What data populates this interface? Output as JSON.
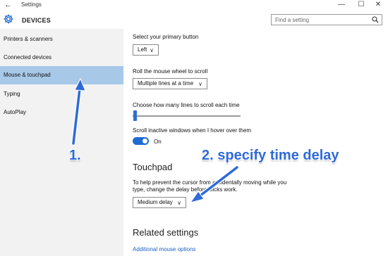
{
  "window": {
    "back_glyph": "←",
    "title": "Settings",
    "min_glyph": "—",
    "max_glyph": "☐",
    "close_glyph": "✕"
  },
  "header": {
    "icon": "gear-icon",
    "section_title": "DEVICES",
    "search_placeholder": "Find a setting",
    "search_icon": "search-icon"
  },
  "sidebar": {
    "items": [
      {
        "label": "Printers & scanners",
        "active": false
      },
      {
        "label": "Connected devices",
        "active": false
      },
      {
        "label": "Mouse & touchpad",
        "active": true
      },
      {
        "label": "Typing",
        "active": false
      },
      {
        "label": "AutoPlay",
        "active": false
      }
    ]
  },
  "main": {
    "primary_button_label": "Select your primary button",
    "primary_button_value": "Left",
    "scroll_wheel_label": "Roll the mouse wheel to scroll",
    "scroll_wheel_value": "Multiple lines at a time",
    "lines_label": "Choose how many lines to scroll each time",
    "lines_slider_level": 0.0,
    "inactive_label": "Scroll inactive windows when I hover over them",
    "inactive_state": "On",
    "touchpad_heading": "Touchpad",
    "touchpad_desc_line1": "To help prevent the cursor from accidentally moving while you",
    "touchpad_desc_line2": "type, change the delay before clicks work.",
    "delay_value": "Medium delay",
    "related_heading": "Related settings",
    "related_link": "Additional mouse options",
    "chevron_glyph": "∨"
  },
  "annotations": {
    "step1": "1.",
    "step2": "2. specify time delay",
    "color": "#2f6ad8"
  },
  "colors": {
    "accent": "#1e6bd1",
    "sidebar_bg": "#f2f2f2",
    "active_bg": "#a8c8e8"
  }
}
